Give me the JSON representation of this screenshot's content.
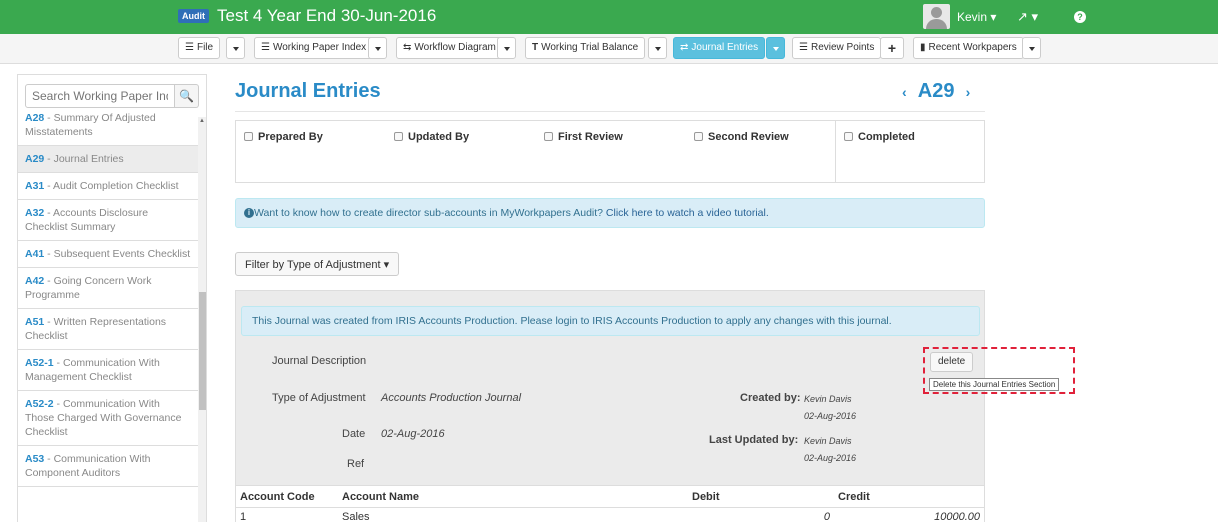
{
  "header": {
    "badge": "Audit",
    "title": "Test 4 Year End 30-Jun-2016",
    "user": "Kevin ▾",
    "tools": "↗ ▾",
    "help": "?"
  },
  "toolbar": {
    "file": "File",
    "working_paper_index": "Working Paper Index",
    "workflow_diagram": "Workflow Diagram",
    "working_trial_balance": "Working Trial Balance",
    "journal_entries": "Journal Entries",
    "review_points": "Review Points",
    "add": "+",
    "recent_workpapers": "Recent Workpapers"
  },
  "sidebar": {
    "search_placeholder": "Search Working Paper Index",
    "search_icon": "🔍",
    "items": [
      {
        "code": "A28",
        "label": " - Summary Of Adjusted Misstatements"
      },
      {
        "code": "A29",
        "label": " - Journal Entries"
      },
      {
        "code": "A31",
        "label": " - Audit Completion Checklist"
      },
      {
        "code": "A32",
        "label": " - Accounts Disclosure Checklist Summary"
      },
      {
        "code": "A41",
        "label": " - Subsequent Events Checklist"
      },
      {
        "code": "A42",
        "label": " - Going Concern Work Programme"
      },
      {
        "code": "A51",
        "label": " - Written Representations Checklist"
      },
      {
        "code": "A52-1",
        "label": " - Communication With Management Checklist"
      },
      {
        "code": "A52-2",
        "label": " - Communication With Those Charged With Governance Checklist"
      },
      {
        "code": "A53",
        "label": " - Communication With Component Auditors"
      }
    ]
  },
  "main": {
    "title": "Journal Entries",
    "prev": "‹",
    "ref": "A29",
    "next": "›",
    "signoff": [
      "Prepared By",
      "Updated By",
      "First Review",
      "Second Review",
      "Completed"
    ],
    "info_text": "Want to know how to create director sub-accounts in MyWorkpapers Audit? ",
    "info_link": "Click here to watch a video tutorial.",
    "filter": "Filter by Type of Adjustment ▾"
  },
  "journal": {
    "notice": "This Journal was created from IRIS Accounts Production. Please login to IRIS Accounts Production to apply any changes with this journal.",
    "description_label": "Journal Description",
    "type_label": "Type of Adjustment",
    "type_value": "Accounts Production Journal",
    "date_label": "Date",
    "date_value": "02-Aug-2016",
    "ref_label": "Ref",
    "created_by_label": "Created by:",
    "created_by_name": "Kevin Davis",
    "created_date": "02-Aug-2016",
    "updated_by_label": "Last Updated by:",
    "updated_by_name": "Kevin Davis",
    "updated_date": "02-Aug-2016",
    "delete_label": "delete",
    "delete_tooltip": "Delete this Journal Entries Section",
    "columns": [
      "Account Code",
      "Account Name",
      "Debit",
      "Credit"
    ],
    "rows": [
      {
        "code": "1",
        "name": "Sales",
        "debit": "0",
        "credit": "10000.00"
      }
    ]
  }
}
